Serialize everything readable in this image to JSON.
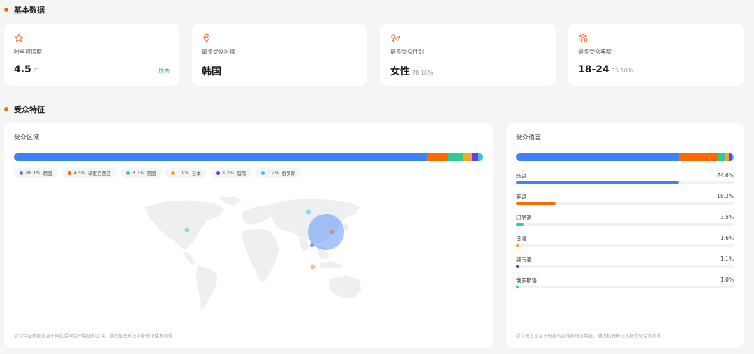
{
  "sections": {
    "basic": "基本数据",
    "audience": "受众特征"
  },
  "stats": [
    {
      "icon": "star-icon",
      "label": "粉丝可信度",
      "value": "4.5",
      "sub": "/5",
      "badge": "优秀"
    },
    {
      "icon": "location-pin-icon",
      "label": "最多受众区域",
      "value": "韩国",
      "sub": "",
      "badge": ""
    },
    {
      "icon": "gender-icon",
      "label": "最多受众性别",
      "value": "女性",
      "sub": "78.10%",
      "badge": ""
    },
    {
      "icon": "people-age-icon",
      "label": "最多受众年龄",
      "value": "18-24",
      "sub": "35.10%",
      "badge": ""
    }
  ],
  "region_panel": {
    "title": "受众区域",
    "footnote": "受众特征数据是基于网红受众用户特征和区域。通过机器算法不断优化估算而得",
    "segments": [
      {
        "name": "韩国",
        "pct_label": "88.1%",
        "value": 88.1,
        "color": "#3d82f6"
      },
      {
        "name": "印度尼西亚",
        "pct_label": "4.5%",
        "value": 4.5,
        "color": "#ff6a00"
      },
      {
        "name": "美国",
        "pct_label": "3.1%",
        "value": 3.1,
        "color": "#36c98d"
      },
      {
        "name": "日本",
        "pct_label": "1.9%",
        "value": 1.9,
        "color": "#f5a623"
      },
      {
        "name": "越南",
        "pct_label": "1.2%",
        "value": 1.2,
        "color": "#6a3de8"
      },
      {
        "name": "俄罗斯",
        "pct_label": "1.2%",
        "value": 1.2,
        "color": "#35c3ea"
      }
    ]
  },
  "language_panel": {
    "title": "受众语言",
    "footnote": "受众语言是基于粉丝的区域和语言特征。通过机器算法不断优化估算而得",
    "languages": [
      {
        "name": "韩语",
        "pct_label": "74.6%",
        "value": 74.6,
        "color": "#3d82f6"
      },
      {
        "name": "英语",
        "pct_label": "18.2%",
        "value": 18.2,
        "color": "#ff6a00"
      },
      {
        "name": "印尼语",
        "pct_label": "3.5%",
        "value": 3.5,
        "color": "#36c98d"
      },
      {
        "name": "日语",
        "pct_label": "1.6%",
        "value": 1.6,
        "color": "#f5a623"
      },
      {
        "name": "越南语",
        "pct_label": "1.1%",
        "value": 1.1,
        "color": "#6a3de8"
      },
      {
        "name": "俄罗斯语",
        "pct_label": "1.0%",
        "value": 1.0,
        "color": "#35c3ea"
      }
    ]
  }
}
